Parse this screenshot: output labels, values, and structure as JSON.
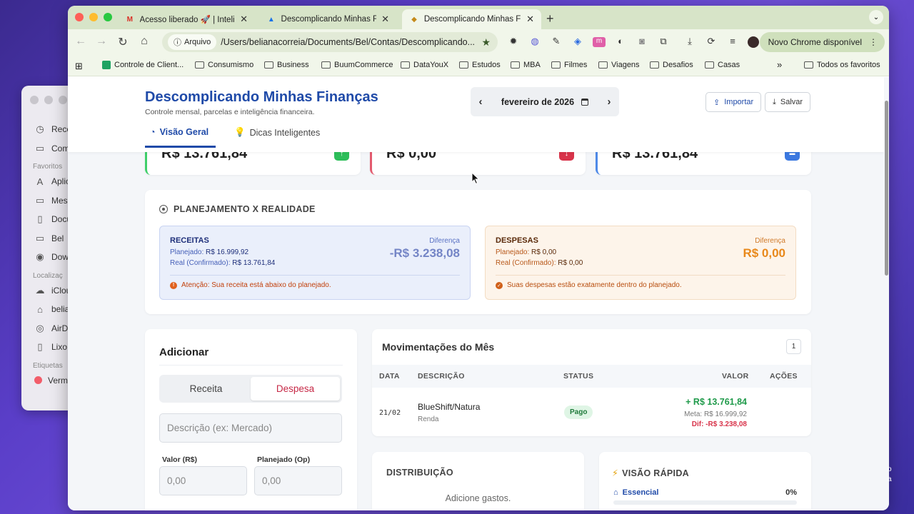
{
  "finder": {
    "items_top": [
      {
        "icon": "clock-icon",
        "glyph": "◷",
        "label": "Rece"
      },
      {
        "icon": "folder-icon",
        "glyph": "▭",
        "label": "Com"
      }
    ],
    "favorites_label": "Favoritos",
    "favorites": [
      {
        "icon": "apps-icon",
        "glyph": "A",
        "label": "Aplic"
      },
      {
        "icon": "desktop-icon",
        "glyph": "▭",
        "label": "Mesa"
      },
      {
        "icon": "document-icon",
        "glyph": "▯",
        "label": "Docu"
      },
      {
        "icon": "folder-icon",
        "glyph": "▭",
        "label": "Bel"
      },
      {
        "icon": "download-icon",
        "glyph": "◉",
        "label": "Dow"
      }
    ],
    "locations_label": "Localizaç",
    "locations": [
      {
        "icon": "cloud-icon",
        "glyph": "☁",
        "label": "iClou"
      },
      {
        "icon": "home-icon",
        "glyph": "⌂",
        "label": "belia"
      },
      {
        "icon": "airdrop-icon",
        "glyph": "◎",
        "label": "AirD"
      },
      {
        "icon": "trash-icon",
        "glyph": "🗑",
        "label": "Lixo"
      }
    ],
    "tags_label": "Etiquetas",
    "tags": [
      {
        "label": "Verm",
        "color": "#f25d6a"
      }
    ]
  },
  "browser": {
    "tabs": [
      {
        "icon": "gmail-icon",
        "title": "Acesso liberado 🚀 | Inteligê",
        "active": false
      },
      {
        "icon": "drive-icon",
        "title": "Descomplicando Minhas Finan",
        "active": false
      },
      {
        "icon": "app-favicon-icon",
        "title": "Descomplicando Minhas Fina",
        "active": true
      }
    ],
    "omnibox": {
      "chip": "Arquivo",
      "url": "/Users/belianacorreia/Documents/Bel/Contas/Descomplicando..."
    },
    "update_label": "Novo Chrome disponível",
    "bookmarks": [
      {
        "label": "Controle de Client...",
        "icon": "sheets-icon"
      },
      {
        "label": "Consumismo",
        "icon": "folder-icon"
      },
      {
        "label": "Business",
        "icon": "folder-icon"
      },
      {
        "label": "BuumCommerce",
        "icon": "folder-icon"
      },
      {
        "label": "DataYouX",
        "icon": "folder-icon"
      },
      {
        "label": "Estudos",
        "icon": "folder-icon"
      },
      {
        "label": "MBA",
        "icon": "folder-icon"
      },
      {
        "label": "Filmes",
        "icon": "folder-icon"
      },
      {
        "label": "Viagens",
        "icon": "folder-icon"
      },
      {
        "label": "Desafios",
        "icon": "folder-icon"
      },
      {
        "label": "Casas",
        "icon": "folder-icon"
      }
    ],
    "bookmarks_more": "»",
    "all_bookmarks": "Todos os favoritos"
  },
  "app": {
    "title": "Descomplicando Minhas Finanças",
    "subtitle": "Controle mensal, parcelas e inteligência financeira.",
    "month": "fevereiro de 2026",
    "import_label": "Importar",
    "save_label": "Salvar",
    "nav": {
      "overview": "Visão Geral",
      "tips": "Dicas Inteligentes"
    },
    "summary": [
      {
        "value": "R$ 13.761,84",
        "color": "#2dbe5a",
        "border": "#3fcf6a",
        "arrow": "↑"
      },
      {
        "value": "R$ 0,00",
        "color": "#d8334a",
        "border": "#e35a6e",
        "arrow": "↓"
      },
      {
        "value": "R$ 13.761,84",
        "color": "#3b78e0",
        "border": "#4f8ae8",
        "arrow": "▬"
      }
    ],
    "planning": {
      "title": "PLANEJAMENTO X REALIDADE",
      "income": {
        "heading": "RECEITAS",
        "planned_label": "Planejado:",
        "planned_value": "R$ 16.999,92",
        "real_label": "Real (Confirmado):",
        "real_value": "R$ 13.761,84",
        "diff_label": "Diferença",
        "diff_value": "-R$ 3.238,08",
        "message": "Atenção: Sua receita está abaixo do planejado."
      },
      "expenses": {
        "heading": "DESPESAS",
        "planned_label": "Planejado:",
        "planned_value": "R$ 0,00",
        "real_label": "Real (Confirmado):",
        "real_value": "R$ 0,00",
        "diff_label": "Diferença",
        "diff_value": "R$ 0,00",
        "message": "Suas despesas estão exatamente dentro do planejado."
      }
    },
    "add": {
      "title": "Adicionar",
      "seg_income": "Receita",
      "seg_expense": "Despesa",
      "desc_placeholder": "Descrição (ex: Mercado)",
      "value_label": "Valor (R$)",
      "value_placeholder": "0,00",
      "planned_label": "Planejado (Op)",
      "planned_placeholder": "0,00"
    },
    "movements": {
      "title": "Movimentações do Mês",
      "page": "1",
      "headers": {
        "date": "DATA",
        "desc": "DESCRIÇÃO",
        "status": "STATUS",
        "value": "VALOR",
        "actions": "AÇÕES"
      },
      "rows": [
        {
          "date": "21/02",
          "desc": "BlueShift/Natura",
          "category": "Renda",
          "status": "Pago",
          "value": "+ R$ 13.761,84",
          "meta": "Meta: R$ 16.999,92",
          "diff": "Dif: -R$ 3.238,08"
        }
      ]
    },
    "distribution": {
      "title": "DISTRIBUIÇÃO",
      "empty": "Adicione gastos."
    },
    "quick": {
      "title": "VISÃO RÁPIDA",
      "essential_label": "Essencial",
      "essential_pct": "0%",
      "essential_fraction": 0
    }
  },
  "desktop_edge": {
    "line1": "o",
    "line2": "a"
  }
}
